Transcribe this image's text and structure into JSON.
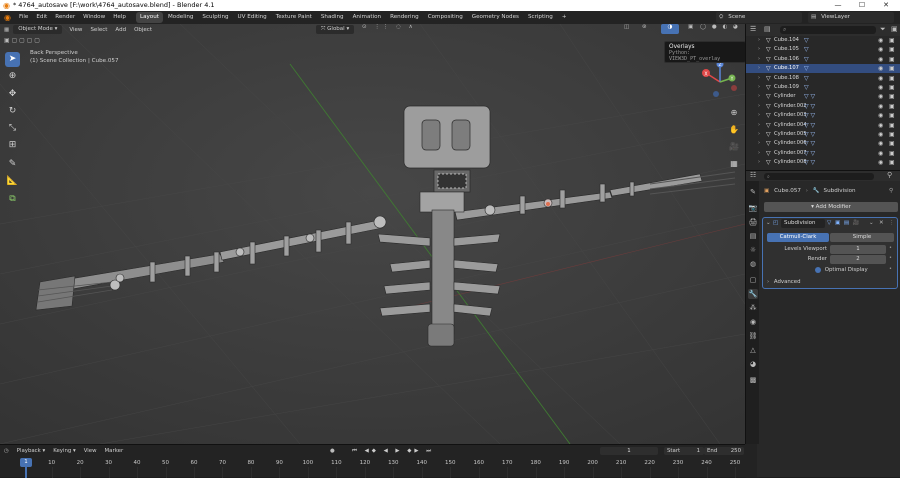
{
  "window": {
    "title": "* 4764_autosave [F:\\work\\4764_autosave.blend] - Blender 4.1",
    "minimize": "—",
    "maximize": "☐",
    "close": "✕"
  },
  "menu": {
    "items": [
      "File",
      "Edit",
      "Render",
      "Window",
      "Help"
    ],
    "workspaces": [
      "Layout",
      "Modeling",
      "Sculpting",
      "UV Editing",
      "Texture Paint",
      "Shading",
      "Animation",
      "Rendering",
      "Compositing",
      "Geometry Nodes",
      "Scripting"
    ],
    "active_workspace": "Layout",
    "add_tab": "+",
    "scene_label": "Scene",
    "viewlayer_label": "ViewLayer"
  },
  "viewport": {
    "mode": "Object Mode",
    "menus": [
      "View",
      "Select",
      "Add",
      "Object"
    ],
    "transform_orientation": "Global",
    "view_name": "Back Perspective",
    "collection_info": "(1) Scene Collection | Cube.057",
    "gizmo": {
      "x": "X",
      "y": "Y",
      "z": "Z"
    }
  },
  "tooltip": {
    "title": "Overlays",
    "python": "Python: VIEW3D_PT_overlay"
  },
  "outliner": {
    "search_placeholder": "",
    "rows": [
      {
        "name": "Cube.104",
        "selected": false
      },
      {
        "name": "Cube.105",
        "selected": false
      },
      {
        "name": "Cube.106",
        "selected": false
      },
      {
        "name": "Cube.107",
        "selected": true
      },
      {
        "name": "Cube.108",
        "selected": false
      },
      {
        "name": "Cube.109",
        "selected": false
      },
      {
        "name": "Cylinder",
        "selected": false
      },
      {
        "name": "Cylinder.002",
        "selected": false
      },
      {
        "name": "Cylinder.003",
        "selected": false
      },
      {
        "name": "Cylinder.004",
        "selected": false
      },
      {
        "name": "Cylinder.005",
        "selected": false
      },
      {
        "name": "Cylinder.006",
        "selected": false
      },
      {
        "name": "Cylinder.007",
        "selected": false
      },
      {
        "name": "Cylinder.008",
        "selected": false
      }
    ]
  },
  "properties": {
    "object_name": "Cube.057",
    "modifier_breadcrumb": "Subdivision",
    "add_modifier": "Add Modifier",
    "modifier": {
      "name": "Subdivision",
      "mode_catmull": "Catmull-Clark",
      "mode_simple": "Simple",
      "levels_viewport_label": "Levels Viewport",
      "levels_viewport_value": "1",
      "render_label": "Render",
      "render_value": "2",
      "optimal_display_label": "Optimal Display",
      "advanced_label": "Advanced"
    }
  },
  "timeline": {
    "menus": [
      "Playback",
      "Keying",
      "View",
      "Marker"
    ],
    "current_frame": "1",
    "start_label": "Start",
    "start_value": "1",
    "end_label": "End",
    "end_value": "250",
    "current_frame_marker": "1",
    "ticks": [
      "10",
      "20",
      "30",
      "40",
      "50",
      "60",
      "70",
      "80",
      "90",
      "100",
      "110",
      "120",
      "130",
      "140",
      "150",
      "160",
      "170",
      "180",
      "190",
      "200",
      "210",
      "220",
      "230",
      "240",
      "250"
    ]
  }
}
